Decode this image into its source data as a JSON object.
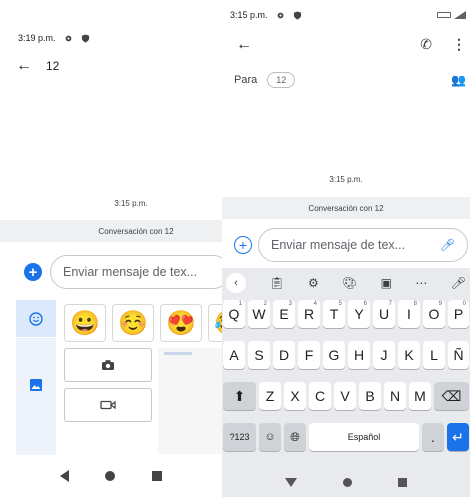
{
  "left": {
    "status": {
      "time": "3:19 p.m."
    },
    "header": {
      "title": "12"
    },
    "thread": {
      "date": "3:15 p.m.",
      "banner": "Conversación con 12"
    },
    "compose": {
      "placeholder": "Enviar mensaje de tex..."
    },
    "emoji_row": [
      "😀",
      "☺️",
      "😍",
      "😂"
    ],
    "icons": [
      "gear-icon",
      "shield-icon",
      "back-arrow-icon",
      "plus-icon",
      "emoji-icon",
      "image-icon",
      "camera-icon",
      "video-icon"
    ],
    "nav": [
      "back",
      "home",
      "recents"
    ]
  },
  "right": {
    "status": {
      "time": "3:15 p.m."
    },
    "recipients": {
      "para_label": "Para",
      "chip": "12"
    },
    "thread": {
      "date": "3:15 p.m.",
      "banner": "Conversación con 12"
    },
    "compose": {
      "placeholder": "Enviar mensaje de tex..."
    },
    "keyboard": {
      "row1": [
        {
          "k": "Q",
          "h": "1"
        },
        {
          "k": "W",
          "h": "2"
        },
        {
          "k": "E",
          "h": "3"
        },
        {
          "k": "R",
          "h": "4"
        },
        {
          "k": "T",
          "h": "5"
        },
        {
          "k": "Y",
          "h": "6"
        },
        {
          "k": "U",
          "h": "7"
        },
        {
          "k": "I",
          "h": "8"
        },
        {
          "k": "O",
          "h": "9"
        },
        {
          "k": "P",
          "h": "0"
        }
      ],
      "row2": [
        "A",
        "S",
        "D",
        "F",
        "G",
        "H",
        "J",
        "K",
        "L",
        "Ñ"
      ],
      "row3": [
        "Z",
        "X",
        "C",
        "V",
        "B",
        "N",
        "M"
      ],
      "symbols_key": "?123",
      "space_label": "Español",
      "period": "."
    },
    "accent_color": "#1a73e8"
  }
}
